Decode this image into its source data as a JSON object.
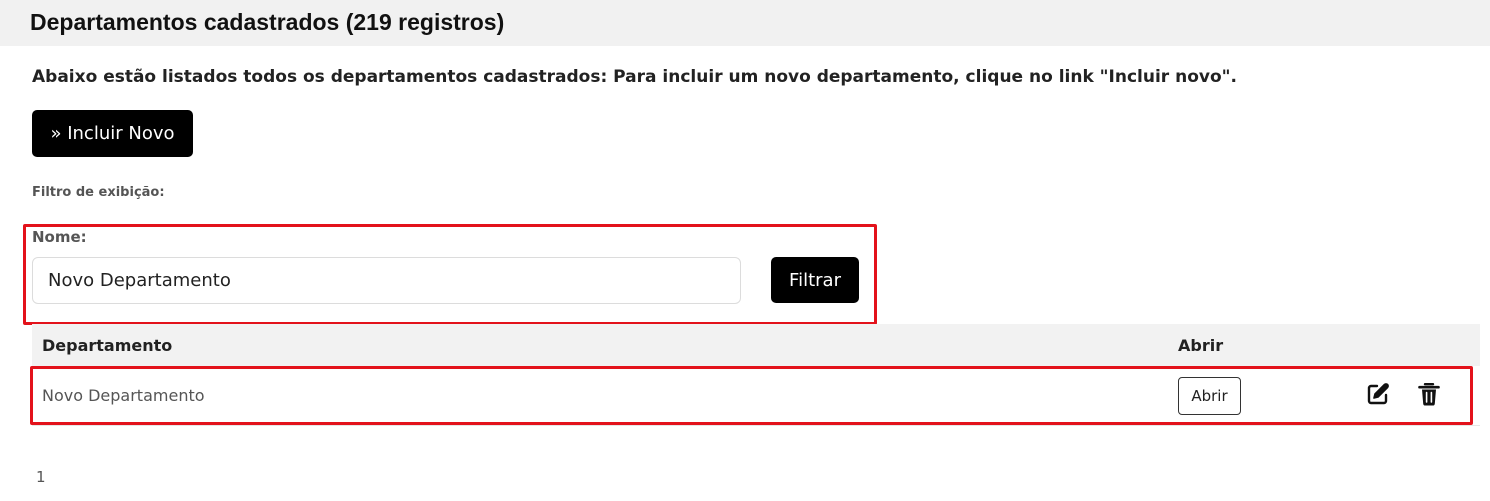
{
  "header": {
    "title": "Departamentos cadastrados (219 registros)"
  },
  "intro_text": "Abaixo estão listados todos os departamentos cadastrados: Para incluir um novo departamento, clique no link \"Incluir novo\".",
  "actions": {
    "new_label": "» Incluir Novo"
  },
  "filter": {
    "caption": "Filtro de exibição:",
    "name_label": "Nome:",
    "name_value": "Novo Departamento",
    "submit_label": "Filtrar"
  },
  "table": {
    "columns": [
      "Departamento",
      "Abrir"
    ],
    "rows": [
      {
        "departamento": "Novo Departamento",
        "open_label": "Abrir",
        "icons": [
          "edit-icon",
          "trash-icon"
        ]
      }
    ]
  },
  "pagination": {
    "current_page": "1"
  },
  "colors": {
    "highlight": "#e3121b",
    "primary_button": "#000000",
    "header_bg": "#f1f1f1"
  }
}
